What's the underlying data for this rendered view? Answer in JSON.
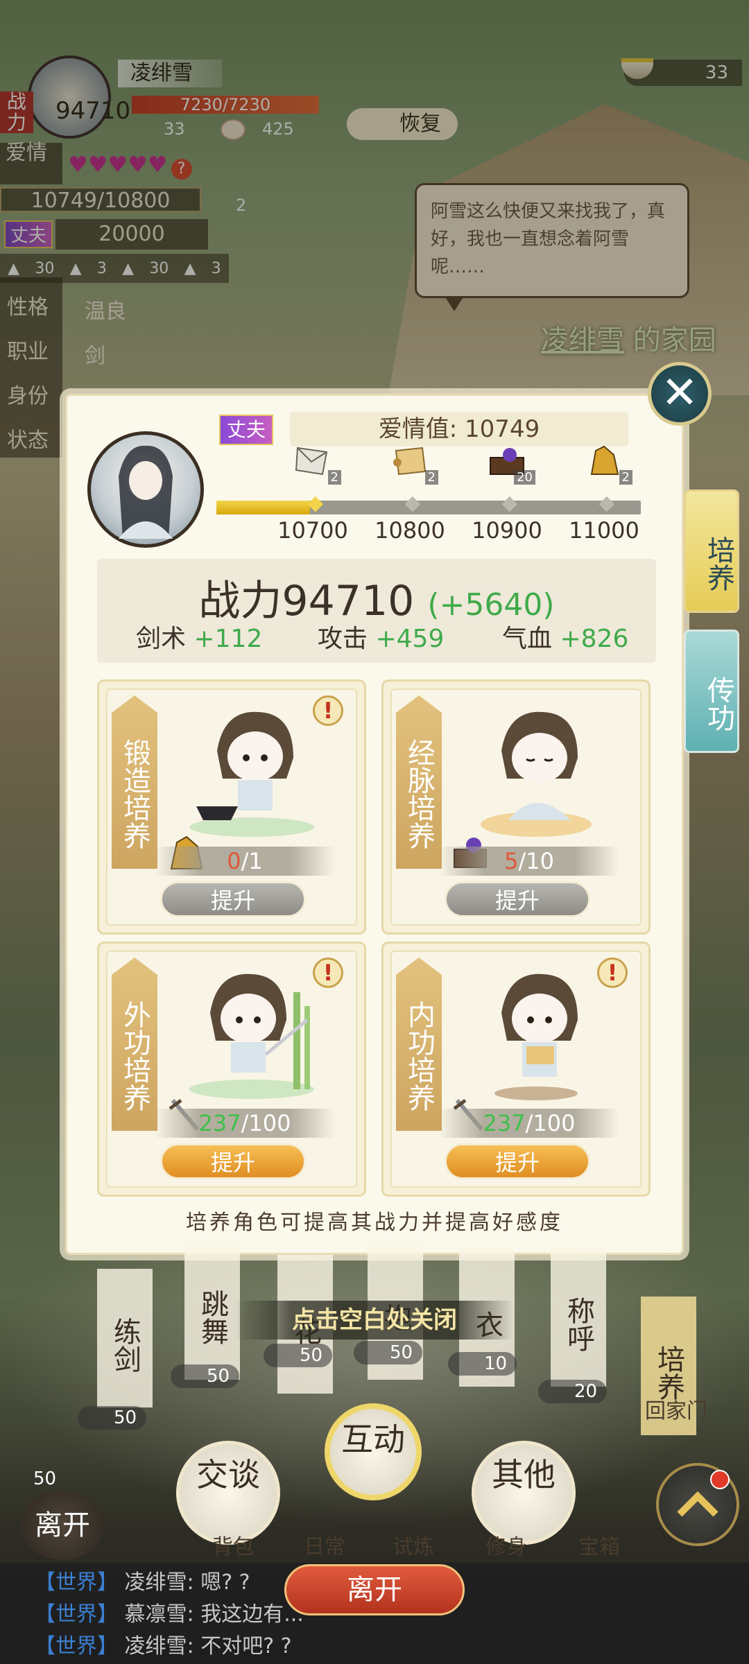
{
  "top_left": {
    "name": "凌绯雪",
    "power_label": "战力",
    "power_value": "94710",
    "hp": "7230/7230",
    "stat_a": "33",
    "stat_b": "425",
    "love_label": "爱情",
    "love_progress": "10749/10800",
    "love_badge_count": "2",
    "spouse_tag": "丈夫",
    "spouse_value": "20000",
    "items": [
      "30",
      "3",
      "30",
      "3"
    ],
    "trait_labels": [
      "性格",
      "职业",
      "身份",
      "状态"
    ],
    "trait_value": "温良",
    "trait_value2": "剑",
    "restore_label": "恢复"
  },
  "top_right": {
    "bowl_count": "33"
  },
  "speech": "阿雪这么快便又来找我了，真好，我也一直想念着阿雪呢……",
  "home_title": {
    "name": "凌绯雪",
    "suffix": "的家园"
  },
  "panel": {
    "spouse_badge": "丈夫",
    "love_value_text": "爱情值: 10749",
    "love_fill_fraction": 0.22,
    "milestones": [
      {
        "value": "10700",
        "count": "2",
        "icon": "letter-icon"
      },
      {
        "value": "10800",
        "count": "2",
        "icon": "scroll-icon"
      },
      {
        "value": "10900",
        "count": "20",
        "icon": "treasure-chest-icon"
      },
      {
        "value": "11000",
        "count": "2",
        "icon": "gold-ore-icon"
      }
    ],
    "power_text": "战力94710",
    "power_delta": "(+5640)",
    "attrs": [
      {
        "label": "剑术",
        "value": "+112"
      },
      {
        "label": "攻击",
        "value": "+459"
      },
      {
        "label": "气血",
        "value": "+826"
      }
    ],
    "cards": [
      {
        "label": "锻造培养",
        "have": "0",
        "need": "/1",
        "button": "提升",
        "enabled": false,
        "alert": true
      },
      {
        "label": "经脉培养",
        "have": "5",
        "need": "/10",
        "button": "提升",
        "enabled": false,
        "alert": false
      },
      {
        "label": "外功培养",
        "have": "237",
        "need": "/100",
        "button": "提升",
        "enabled": true,
        "alert": true
      },
      {
        "label": "内功培养",
        "have": "237",
        "need": "/100",
        "button": "提升",
        "enabled": true,
        "alert": true
      }
    ],
    "hint": "培养角色可提高其战力并提高好感度",
    "tabs": [
      "培养",
      "传功"
    ]
  },
  "close_hint": "点击空白处关闭",
  "options": [
    "练剑",
    "跳舞",
    "花",
    "抱",
    "衣",
    "称呼",
    "培养"
  ],
  "option_costs": [
    "50",
    "50",
    "50",
    "50",
    "10",
    "20",
    "50"
  ],
  "round_buttons": [
    "交谈",
    "互动",
    "其他"
  ],
  "bottom_nav": [
    "背包",
    "日常",
    "试炼",
    "修身",
    "宝箱"
  ],
  "left_bottom": {
    "value": "50",
    "label": "离开"
  },
  "door_label": "回家门",
  "leave_button": "离开",
  "chat": [
    {
      "channel": "【世界】",
      "text": "凌绯雪: 嗯? ?"
    },
    {
      "channel": "【世界】",
      "text": "慕凛雪: 我这边有..."
    },
    {
      "channel": "【世界】",
      "text": "凌绯雪: 不对吧? ?"
    }
  ],
  "colors": {
    "accent_green": "#3faa4a",
    "love_gold": "#e6b820",
    "teal": "#2e5f6a"
  }
}
